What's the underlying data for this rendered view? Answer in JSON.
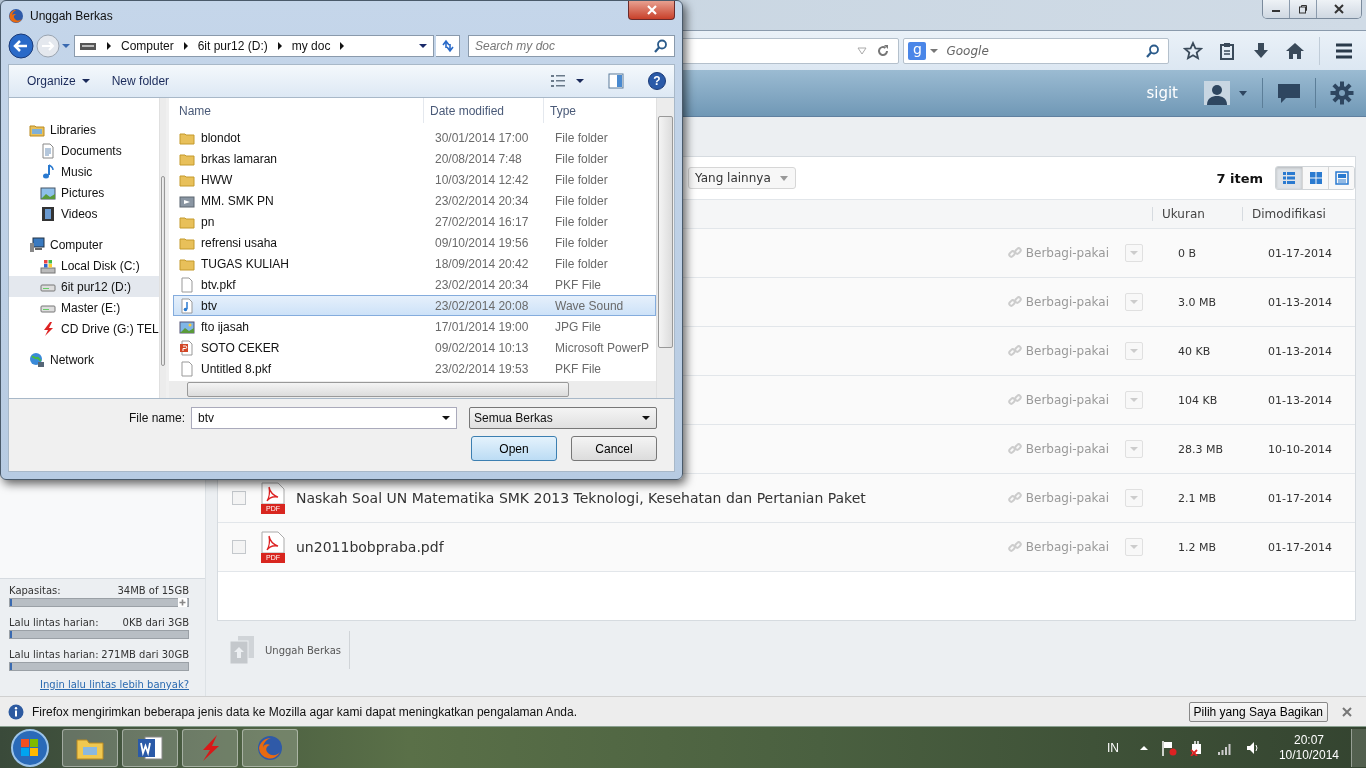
{
  "dialog": {
    "title": "Unggah Berkas",
    "breadcrumb": [
      "Computer",
      "6it pur12 (D:)",
      "my doc"
    ],
    "search": {
      "placeholder": "Search my doc"
    },
    "commands": [
      "Organize",
      "New folder"
    ],
    "help_icon": "?",
    "nav": [
      {
        "label": "Libraries",
        "kind": "libraries",
        "selected": false,
        "children": [
          {
            "label": "Documents",
            "kind": "documents",
            "selected": false
          },
          {
            "label": "Music",
            "kind": "music",
            "selected": false
          },
          {
            "label": "Pictures",
            "kind": "pictures",
            "selected": false
          },
          {
            "label": "Videos",
            "kind": "videos",
            "selected": false
          }
        ]
      },
      {
        "label": "Computer",
        "kind": "computer",
        "selected": false,
        "children": [
          {
            "label": "Local Disk (C:)",
            "kind": "system-drive",
            "selected": false
          },
          {
            "label": "6it pur12 (D:)",
            "kind": "drive",
            "selected": true
          },
          {
            "label": "Master (E:)",
            "kind": "drive",
            "selected": false
          },
          {
            "label": "CD Drive (G:) TEL",
            "kind": "cd",
            "selected": false
          }
        ]
      },
      {
        "label": "Network",
        "kind": "network",
        "selected": false
      }
    ],
    "columns": [
      "Name",
      "Date modified",
      "Type"
    ],
    "files": [
      {
        "name": "blondot",
        "date": "30/01/2014 17:00",
        "type": "File folder",
        "kind": "folder",
        "selected": false
      },
      {
        "name": "brkas lamaran",
        "date": "20/08/2014 7:48",
        "type": "File folder",
        "kind": "folder",
        "selected": false
      },
      {
        "name": "HWW",
        "date": "10/03/2014 12:42",
        "type": "File folder",
        "kind": "folder",
        "selected": false
      },
      {
        "name": "MM. SMK PN",
        "date": "23/02/2014 20:34",
        "type": "File folder",
        "kind": "media-folder",
        "selected": false
      },
      {
        "name": "pn",
        "date": "27/02/2014 16:17",
        "type": "File folder",
        "kind": "folder",
        "selected": false
      },
      {
        "name": "refrensi usaha",
        "date": "09/10/2014 19:56",
        "type": "File folder",
        "kind": "folder",
        "selected": false
      },
      {
        "name": "TUGAS KULIAH",
        "date": "18/09/2014 20:42",
        "type": "File folder",
        "kind": "folder",
        "selected": false
      },
      {
        "name": "btv.pkf",
        "date": "23/02/2014 20:34",
        "type": "PKF File",
        "kind": "file",
        "selected": false
      },
      {
        "name": "btv",
        "date": "23/02/2014 20:08",
        "type": "Wave Sound",
        "kind": "audio",
        "selected": true
      },
      {
        "name": "fto ijasah",
        "date": "17/01/2014 19:00",
        "type": "JPG File",
        "kind": "image",
        "selected": false
      },
      {
        "name": "SOTO CEKER",
        "date": "09/02/2014 10:13",
        "type": "Microsoft PowerP",
        "kind": "slides",
        "selected": false
      },
      {
        "name": "Untitled 8.pkf",
        "date": "23/02/2014 19:53",
        "type": "PKF File",
        "kind": "file",
        "selected": false
      }
    ],
    "file_name": {
      "label": "File name:",
      "value": "btv"
    },
    "filter": "Semua Berkas",
    "buttons": [
      "Open",
      "Cancel"
    ]
  },
  "browser": {
    "search": {
      "engine_icon": "g",
      "placeholder": "Google"
    }
  },
  "header": {
    "user": "sigit"
  },
  "toolbar": {
    "more_button": "Yang lainnya",
    "count": "7 item",
    "views": [
      {
        "kind": "list",
        "selected": true
      },
      {
        "kind": "grid",
        "selected": false
      },
      {
        "kind": "detail",
        "selected": false
      }
    ]
  },
  "table": {
    "columns": [
      "Ukuran",
      "Dimodifikasi"
    ],
    "rows": [
      {
        "share": "Berbagi-pakai",
        "size": "0 B",
        "modified": "01-17-2014"
      },
      {
        "share": "Berbagi-pakai",
        "size": "3.0 MB",
        "modified": "01-13-2014"
      },
      {
        "share": "Berbagi-pakai",
        "size": "40 KB",
        "modified": "01-13-2014"
      },
      {
        "share": "Berbagi-pakai",
        "size": "104 KB",
        "modified": "01-13-2014"
      },
      {
        "share": "Berbagi-pakai",
        "size": "28.3 MB",
        "modified": "10-10-2014"
      },
      {
        "name": "Naskah Soal UN Matematika SMK 2013 Teknologi, Kesehatan dan Pertanian Paket",
        "kind": "pdf",
        "icon_label": "PDF",
        "share": "Berbagi-pakai",
        "size": "2.1 MB",
        "modified": "01-17-2014",
        "checked": false
      },
      {
        "name": "un2011bobpraba.pdf",
        "kind": "pdf",
        "icon_label": "PDF",
        "share": "Berbagi-pakai",
        "size": "1.2 MB",
        "modified": "01-17-2014",
        "checked": false
      }
    ]
  },
  "quotas": [
    {
      "label": "Kapasitas:",
      "value": "34MB of 15GB",
      "level": 0.01,
      "expandable": true
    },
    {
      "label": "Lalu lintas harian:",
      "value": "0KB dari 3GB",
      "level": 0
    },
    {
      "label": "Lalu lintas harian:",
      "value": "271MB dari 30GB",
      "level": 0.01
    }
  ],
  "quota_link": "Ingin lalu lintas lebih banyak?",
  "upload": {
    "label": "Unggah Berkas"
  },
  "notification": {
    "text": "Firefox mengirimkan beberapa jenis data ke Mozilla agar kami dapat meningkatkan pengalaman Anda.",
    "button": "Pilih yang Saya Bagikan"
  },
  "taskbar": {
    "apps": [
      {
        "kind": "explorer"
      },
      {
        "kind": "word"
      },
      {
        "kind": "lightning"
      },
      {
        "kind": "firefox"
      }
    ],
    "language": "IN",
    "time": "20:07",
    "date": "10/10/2014"
  }
}
